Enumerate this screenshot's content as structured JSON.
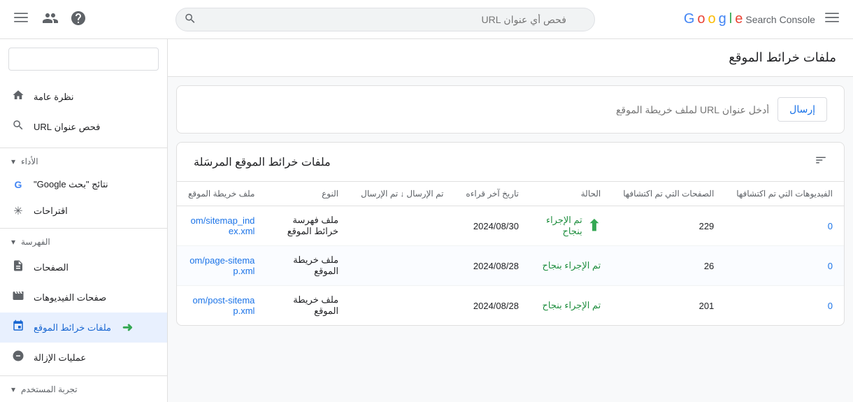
{
  "topbar": {
    "search_placeholder": "فحص أي عنوان URL",
    "hamburger_label": "☰",
    "google_logo": {
      "G": "G",
      "o1": "o",
      "o2": "o",
      "g": "g",
      "l": "l",
      "e": "e",
      "sc": "Search Console"
    }
  },
  "sidebar": {
    "search_placeholder": "",
    "overview_label": "نظرة عامة",
    "url_inspect_label": "فحص عنوان URL",
    "performance_label": "الأداء",
    "google_search_label": "نتائج \"بحث Google\"",
    "discover_label": "اقتراحات",
    "indexing_label": "الفهرسة",
    "pages_label": "الصفحات",
    "video_pages_label": "صفحات الفيديوهات",
    "sitemaps_label": "ملفات خرائط الموقع",
    "removals_label": "عمليات الإزالة",
    "experience_label": "تجربة المستخدم"
  },
  "page": {
    "title": "ملفات خرائط الموقع",
    "table_title": "ملفات خرائط الموقع المرسَلة",
    "submit_placeholder": "أدخل عنوان URL لملف خريطة الموقع",
    "submit_btn": "إرسال",
    "columns": {
      "sitemap": "ملف خريطة الموقع",
      "type": "النوع",
      "submitted": "تم الإرسال",
      "last_read": "تاريخ آخر قراءه",
      "status": "الحالة",
      "pages": "الصفحات التي تم اكتشافها",
      "videos": "الفيديوهات التي تم اكتشافها"
    },
    "rows": [
      {
        "sitemap": "om/sitemap_ind",
        "sitemap2": "ex.xml",
        "type": "ملف فهرسة خرائط الموقع",
        "submitted": "",
        "last_read": "2024/08/30",
        "status": "تم الإجراء بنجاح",
        "pages": "229",
        "videos": "0"
      },
      {
        "sitemap": "om/page-sitema",
        "sitemap2": "p.xml",
        "type": "ملف خريطة الموقع",
        "submitted": "",
        "last_read": "2024/08/28",
        "status": "تم الإجراء بنجاح",
        "pages": "26",
        "videos": "0"
      },
      {
        "sitemap": "om/post-sitema",
        "sitemap2": "p.xml",
        "type": "ملف خريطة الموقع",
        "submitted": "",
        "last_read": "2024/08/28",
        "status": "تم الإجراء بنجاح",
        "pages": "201",
        "videos": "0"
      }
    ]
  }
}
